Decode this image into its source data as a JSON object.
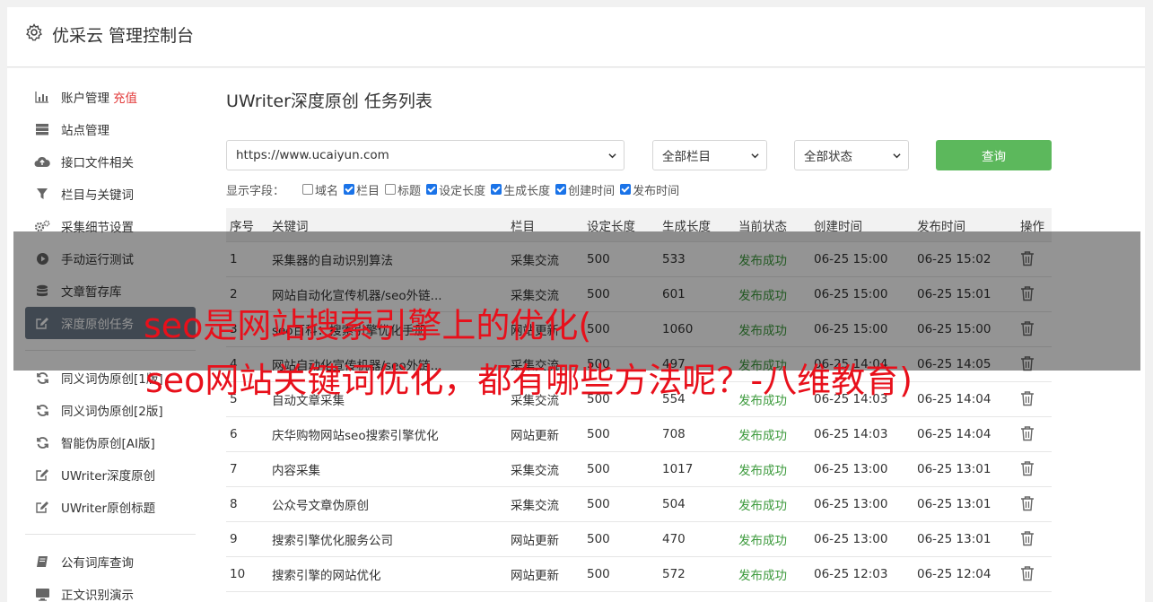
{
  "header": {
    "title": "优采云 管理控制台",
    "icon": "gear-icon"
  },
  "sidebar": {
    "groups": [
      [
        {
          "label": "账户管理",
          "icon": "bar-chart-icon",
          "badge": "充值"
        },
        {
          "label": "站点管理",
          "icon": "server-icon"
        },
        {
          "label": "接口文件相关",
          "icon": "cloud-upload-icon"
        },
        {
          "label": "栏目与关键词",
          "icon": "filter-icon"
        },
        {
          "label": "采集细节设置",
          "icon": "cogs-icon"
        },
        {
          "label": "手动运行测试",
          "icon": "play-circle-icon"
        },
        {
          "label": "文章暂存库",
          "icon": "database-icon"
        },
        {
          "label": "深度原创任务",
          "icon": "edit-icon",
          "active": true
        }
      ],
      [
        {
          "label": "同义词伪原创[1版]",
          "icon": "refresh-icon"
        },
        {
          "label": "同义词伪原创[2版]",
          "icon": "refresh-icon"
        },
        {
          "label": "智能伪原创[AI版]",
          "icon": "refresh-icon"
        },
        {
          "label": "UWriter深度原创",
          "icon": "edit-icon"
        },
        {
          "label": "UWriter原创标题",
          "icon": "edit-icon"
        }
      ],
      [
        {
          "label": "公有词库查询",
          "icon": "book-icon"
        },
        {
          "label": "正文识别演示",
          "icon": "monitor-icon"
        }
      ]
    ]
  },
  "main": {
    "title": "UWriter深度原创 任务列表",
    "site_select": "https://www.ucaiyun.com",
    "category_select": "全部栏目",
    "status_select": "全部状态",
    "query_label": "查询",
    "fields_label": "显示字段：",
    "fields": [
      {
        "label": "域名",
        "checked": false
      },
      {
        "label": "栏目",
        "checked": true
      },
      {
        "label": "标题",
        "checked": false
      },
      {
        "label": "设定长度",
        "checked": true
      },
      {
        "label": "生成长度",
        "checked": true
      },
      {
        "label": "创建时间",
        "checked": true
      },
      {
        "label": "发布时间",
        "checked": true
      }
    ],
    "columns": [
      "序号",
      "关键词",
      "栏目",
      "设定长度",
      "生成长度",
      "当前状态",
      "创建时间",
      "发布时间",
      "操作"
    ],
    "rows": [
      {
        "no": "1",
        "kw": "采集器的自动识别算法",
        "cat": "采集交流",
        "len": "500",
        "gen": "533",
        "st": "发布成功",
        "ct": "06-25 15:00",
        "pt": "06-25 15:02"
      },
      {
        "no": "2",
        "kw": "网站自动化宣传机器/seo外链...",
        "cat": "采集交流",
        "len": "500",
        "gen": "601",
        "st": "发布成功",
        "ct": "06-25 15:00",
        "pt": "06-25 15:01"
      },
      {
        "no": "3",
        "kw": "seo百科：搜索引擎优化手册",
        "cat": "网站更新",
        "len": "500",
        "gen": "1060",
        "st": "发布成功",
        "ct": "06-25 15:00",
        "pt": "06-25 15:00"
      },
      {
        "no": "4",
        "kw": "网站自动化宣传机器/seo外链...",
        "cat": "采集交流",
        "len": "500",
        "gen": "497",
        "st": "发布成功",
        "ct": "06-25 14:04",
        "pt": "06-25 14:05"
      },
      {
        "no": "5",
        "kw": "自动文章采集",
        "cat": "采集交流",
        "len": "500",
        "gen": "554",
        "st": "发布成功",
        "ct": "06-25 14:03",
        "pt": "06-25 14:04"
      },
      {
        "no": "6",
        "kw": "庆华购物网站seo搜索引擎优化",
        "cat": "网站更新",
        "len": "500",
        "gen": "708",
        "st": "发布成功",
        "ct": "06-25 14:03",
        "pt": "06-25 14:04"
      },
      {
        "no": "7",
        "kw": "内容采集",
        "cat": "采集交流",
        "len": "500",
        "gen": "1017",
        "st": "发布成功",
        "ct": "06-25 13:00",
        "pt": "06-25 13:01"
      },
      {
        "no": "8",
        "kw": "公众号文章伪原创",
        "cat": "采集交流",
        "len": "500",
        "gen": "504",
        "st": "发布成功",
        "ct": "06-25 13:00",
        "pt": "06-25 13:01"
      },
      {
        "no": "9",
        "kw": "搜索引擎优化服务公司",
        "cat": "网站更新",
        "len": "500",
        "gen": "470",
        "st": "发布成功",
        "ct": "06-25 13:00",
        "pt": "06-25 13:01"
      },
      {
        "no": "10",
        "kw": "搜索引擎的网站优化",
        "cat": "网站更新",
        "len": "500",
        "gen": "572",
        "st": "发布成功",
        "ct": "06-25 12:03",
        "pt": "06-25 12:04"
      }
    ]
  },
  "overlay": {
    "line1": "seo是网站搜索引擎上的优化(",
    "line2": "seo网站关键词优化，都有哪些方法呢？-八维教育)"
  }
}
